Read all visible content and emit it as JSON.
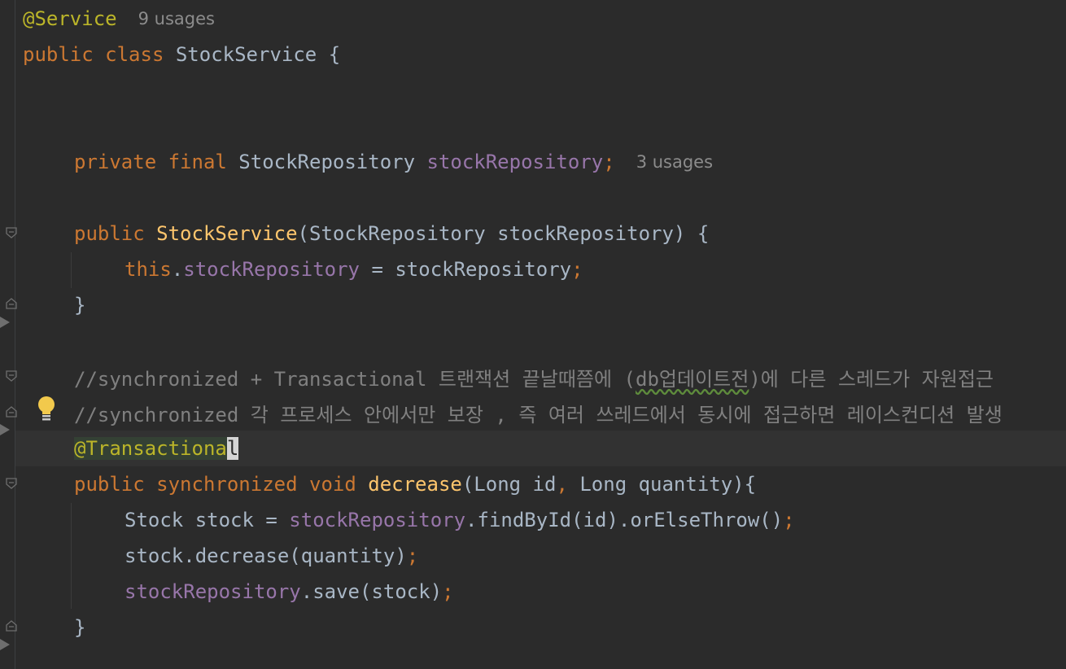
{
  "editor": {
    "lines": {
      "l1": {
        "annotation": "@Service",
        "hint": "9 usages"
      },
      "l2": {
        "kw1": "public ",
        "kw2": "class ",
        "name": "StockService ",
        "brace": "{"
      },
      "l3": {
        "kw1": "private ",
        "kw2": "final ",
        "type": "StockRepository ",
        "field": "stockRepository",
        "semi": ";",
        "hint": "3 usages"
      },
      "l4": {
        "kw1": "public ",
        "method": "StockService",
        "params": "(StockRepository stockRepository) {"
      },
      "l5": {
        "this": "this",
        "dot": ".",
        "field": "stockRepository",
        "rest": " = stockRepository",
        "semi": ";"
      },
      "l6": {
        "text": "}"
      },
      "l7": {
        "c1": "//synchronized + Transactional 트랜잭션 끝날때쯤에 (",
        "c2": "db업데이트전",
        "c3": ")에 다른 스레드가 자원접근"
      },
      "l8": {
        "text": "//synchronized 각 프로세스 안에서만 보장 , 즉 여러 쓰레드에서 동시에 접근하면 레이스컨디션 발생"
      },
      "l9": {
        "ann": "@Transactiona",
        "caret": "l"
      },
      "l10": {
        "kw1": "public ",
        "kw2": "synchronized ",
        "kw3": "void ",
        "method": "decrease",
        "p1": "(Long id",
        "comma": ",",
        "p2": " Long quantity){"
      },
      "l11": {
        "a": "Stock stock = ",
        "field": "stockRepository",
        "b": ".findById(id).orElseThrow()",
        "semi": ";"
      },
      "l12": {
        "a": "stock.decrease(quantity)",
        "semi": ";"
      },
      "l13": {
        "field": "stockRepository",
        "a": ".save(stock)",
        "semi": ";"
      },
      "l14": {
        "text": "}"
      }
    }
  },
  "icons": {
    "gutter": [
      "fold-icon",
      "breakpoint-arrow-icon"
    ],
    "intention": "lightbulb-icon"
  },
  "colors": {
    "background": "#2b2b2b",
    "keyword": "#cc7832",
    "annotation": "#bbb529",
    "field": "#9876aa",
    "method": "#ffc66d",
    "comment": "#808080",
    "hint": "#8c8c8c"
  }
}
